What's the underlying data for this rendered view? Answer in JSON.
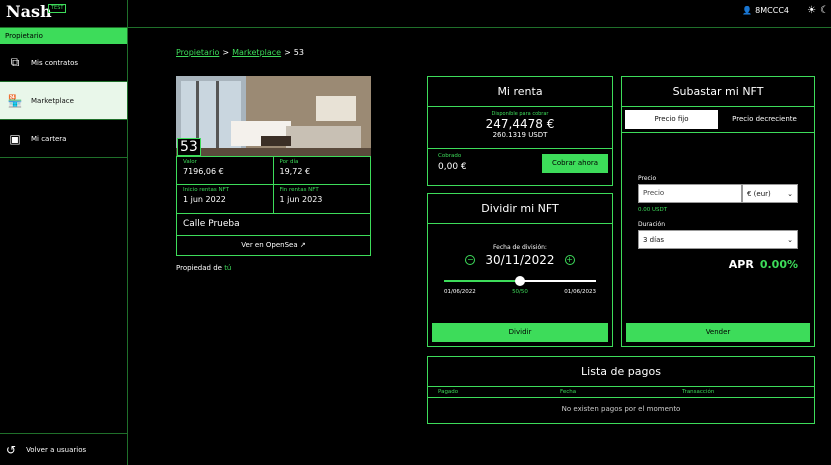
{
  "app": {
    "logo": "Nash",
    "badge": "TEST"
  },
  "topbar": {
    "user": "8MCCC4"
  },
  "sidebar": {
    "header": "Propietario",
    "items": [
      {
        "label": "Mis contratos",
        "icon": "contracts-icon"
      },
      {
        "label": "Marketplace",
        "icon": "store-icon",
        "active": true
      },
      {
        "label": "Mi cartera",
        "icon": "wallet-icon"
      }
    ],
    "bottom": "Volver a usuarios"
  },
  "breadcrumb": {
    "a": "Propietario",
    "b": "Marketplace",
    "c": "53"
  },
  "property": {
    "number": "53",
    "valor_label": "Valor",
    "valor": "7196,06 €",
    "dia_label": "Por día",
    "dia": "19,72 €",
    "inicio_label": "Inicio rentas NFT",
    "inicio": "1 jun 2022",
    "fin_label": "Fin rentas NFT",
    "fin": "1 jun 2023",
    "address": "Calle Prueba",
    "opensea": "Ver en OpenSea",
    "owner_label": "Propiedad de",
    "owner": "tú"
  },
  "renta": {
    "title": "Mi renta",
    "disp_label": "Disponible para cobrar",
    "disp_eur": "247,4478 €",
    "disp_usdt": "260.1319 USDT",
    "cobrado_label": "Cobrado",
    "cobrado": "0,00 €",
    "cobrar_btn": "Cobrar ahora"
  },
  "dividir": {
    "title": "Dividir mi NFT",
    "fecha_label": "Fecha de división:",
    "fecha": "30/11/2022",
    "start": "01/06/2022",
    "mid": "50/50",
    "end": "01/06/2023",
    "split_fraction": 0.5,
    "btn": "Dividir"
  },
  "subastar": {
    "title": "Subastar mi NFT",
    "tab1": "Precio fijo",
    "tab2": "Precio decreciente",
    "precio_label": "Precio",
    "precio_placeholder": "Precio",
    "currency": "€ (eur)",
    "usdt_hint": "0.00 USDT",
    "duracion_label": "Duración",
    "duracion": "3 días",
    "apr_label": "APR",
    "apr_value": "0.00%",
    "btn": "Vender"
  },
  "pagos": {
    "title": "Lista de pagos",
    "cols": [
      "Pagado",
      "Fecha",
      "Transacción"
    ],
    "empty": "No existen pagos por el momento"
  },
  "colors": {
    "accent": "#3ddc5a"
  }
}
